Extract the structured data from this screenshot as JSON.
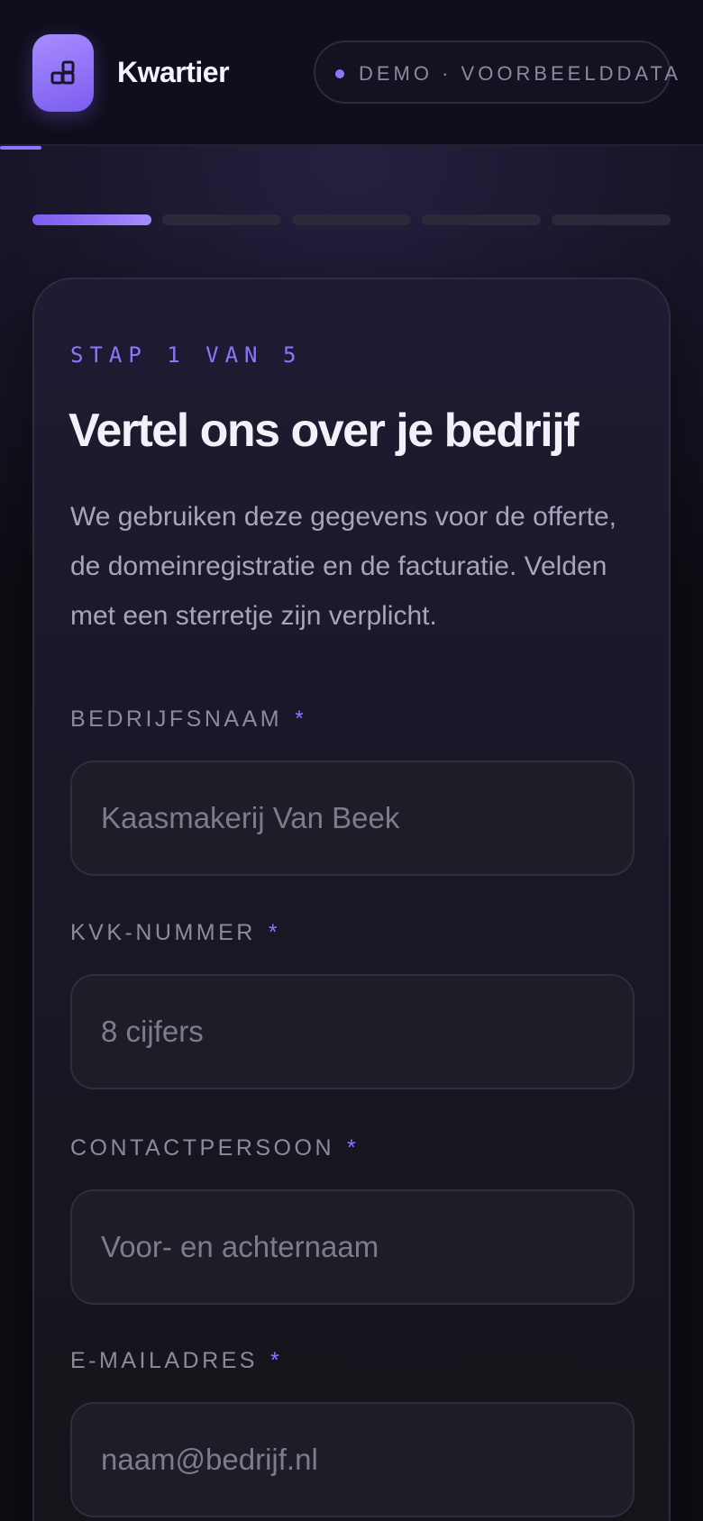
{
  "header": {
    "brand": "Kwartier",
    "logo_icon": "blocks-icon",
    "demo_badge": "DEMO · VOORBEELDDATA"
  },
  "stepper": {
    "total": 5,
    "current": 1
  },
  "form": {
    "step_label": "STAP 1 VAN 5",
    "title": "Vertel ons over je bedrijf",
    "lead": "We gebruiken deze gegevens voor de offerte, de domeinregistratie en de facturatie. Velden met een sterretje zijn verplicht.",
    "required_marker": "*",
    "fields": [
      {
        "label": "BEDRIJFSNAAM",
        "value": "",
        "placeholder": "Kaasmakerij Van Beek"
      },
      {
        "label": "KVK-NUMMER",
        "value": "",
        "placeholder": "8 cijfers"
      },
      {
        "label": "CONTACTPERSOON",
        "value": "",
        "placeholder": "Voor- en achternaam"
      },
      {
        "label": "E-MAILADRES",
        "value": "",
        "placeholder": "naam@bedrijf.nl"
      }
    ]
  },
  "colors": {
    "accent": "#8f74ff",
    "background": "#0b0b12",
    "card": "#1a1828"
  }
}
